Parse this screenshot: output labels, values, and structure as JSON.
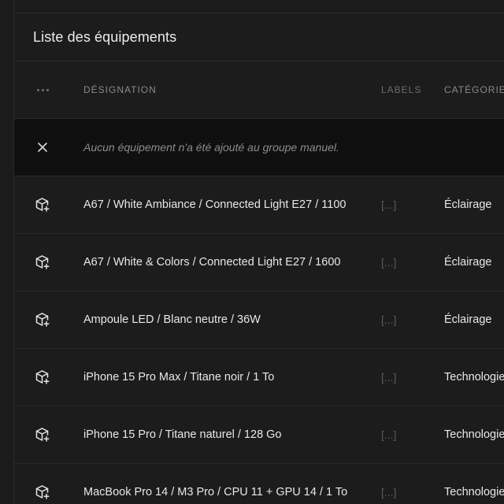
{
  "panel": {
    "title": "Liste des équipements"
  },
  "table": {
    "headers": {
      "actions": "more-horizontal-icon",
      "designation": "DÉSIGNATION",
      "labels": "LABELS",
      "category": "CATÉGORIE"
    },
    "empty_message": "Aucun équipement n'a été ajouté au groupe manuel.",
    "rows": [
      {
        "name": "A67 / White Ambiance / Connected Light E27 / 1100",
        "labels": "[...]",
        "category": "Éclairage",
        "icon": "package-plus-icon"
      },
      {
        "name": "A67 / White & Colors / Connected Light E27 / 1600",
        "labels": "[...]",
        "category": "Éclairage",
        "icon": "package-plus-icon"
      },
      {
        "name": "Ampoule LED / Blanc neutre / 36W",
        "labels": "[...]",
        "category": "Éclairage",
        "icon": "package-plus-icon"
      },
      {
        "name": "iPhone 15 Pro Max / Titane noir / 1 To",
        "labels": "[...]",
        "category": "Technologie",
        "icon": "package-plus-icon"
      },
      {
        "name": "iPhone 15 Pro / Titane naturel / 128 Go",
        "labels": "[...]",
        "category": "Technologie",
        "icon": "package-plus-icon"
      },
      {
        "name": "MacBook Pro 14 / M3 Pro / CPU 11 + GPU 14 / 1 To",
        "labels": "[...]",
        "category": "Technologie",
        "icon": "package-plus-icon"
      }
    ]
  },
  "colors": {
    "background": "#1b1b1b",
    "empty_row": "#0f0f0f",
    "text": "#e8e8e8",
    "muted": "#5a5a5a"
  }
}
